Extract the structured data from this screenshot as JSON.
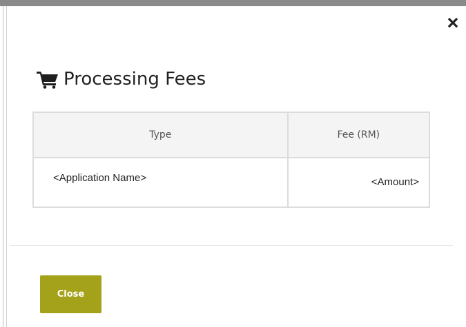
{
  "modal": {
    "title": "Processing Fees",
    "close_icon": "close-x-icon",
    "title_icon": "shopping-cart-icon"
  },
  "table": {
    "headers": [
      "Type",
      "Fee (RM)"
    ],
    "rows": [
      [
        "<Application Name>",
        "<Amount>"
      ]
    ]
  },
  "footer": {
    "close_label": "Close"
  },
  "colors": {
    "button": "#a4a11a",
    "header_bg": "#f4f4f4",
    "border": "#dcdcdc"
  }
}
